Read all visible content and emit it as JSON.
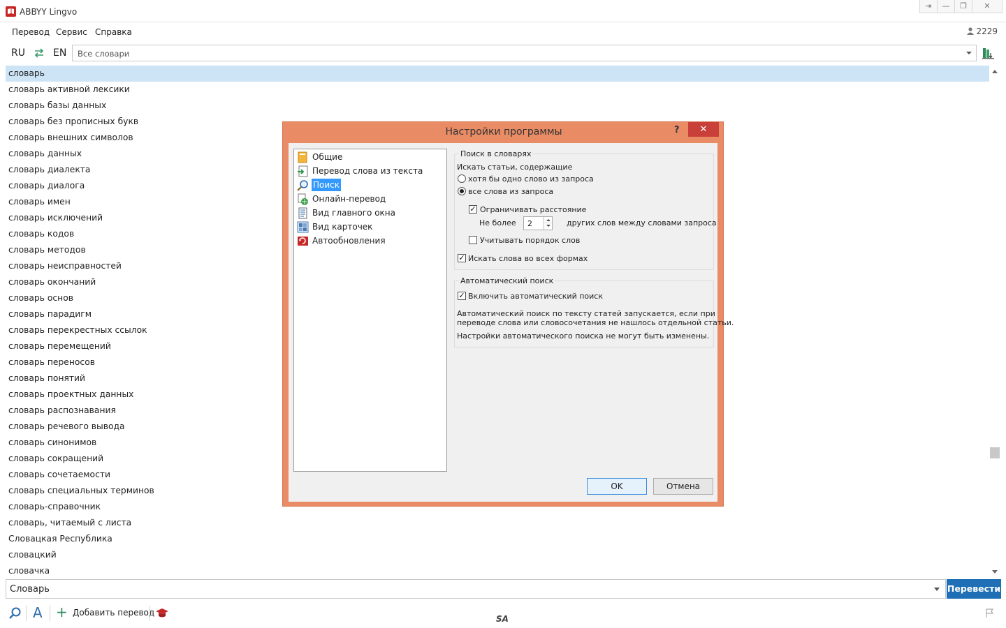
{
  "window": {
    "title": "ABBYY Lingvo",
    "pin_glyph": "⇥",
    "minimize_glyph": "—",
    "restore_glyph": "❐",
    "close_glyph": "✕"
  },
  "menu": {
    "items": [
      "Перевод",
      "Сервис",
      "Справка"
    ],
    "counter": "2229"
  },
  "toolbar": {
    "source_lang": "RU",
    "target_lang": "EN",
    "dictionary_filter": "Все словари"
  },
  "word_list": [
    "словарь",
    "словарь активной лексики",
    "словарь базы данных",
    "словарь без прописных букв",
    "словарь внешних символов",
    "словарь данных",
    "словарь диалекта",
    "словарь диалога",
    "словарь имен",
    "словарь исключений",
    "словарь кодов",
    "словарь методов",
    "словарь неисправностей",
    "словарь окончаний",
    "словарь основ",
    "словарь парадигм",
    "словарь перекрестных ссылок",
    "словарь перемещений",
    "словарь переносов",
    "словарь понятий",
    "словарь проектных данных",
    "словарь распознавания",
    "словарь речевого вывода",
    "словарь синонимов",
    "словарь сокращений",
    "словарь сочетаемости",
    "словарь специальных терминов",
    "словарь-справочник",
    "словарь, читаемый с листа",
    "Словацкая Республика",
    "словацкий",
    "словачка"
  ],
  "search_input": {
    "value": "Словарь",
    "translate_button": "Перевести"
  },
  "statusbar": {
    "add_translation": "Добавить перевод",
    "sa_label": "SA",
    "font_glyph": "A",
    "plus_glyph": "+"
  },
  "dialog": {
    "title": "Настройки программы",
    "help_glyph": "?",
    "close_glyph": "✕",
    "nav": [
      {
        "label": "Общие",
        "icon": "general-icon"
      },
      {
        "label": "Перевод слова из текста",
        "icon": "text-translate-icon"
      },
      {
        "label": "Поиск",
        "icon": "search-icon"
      },
      {
        "label": "Онлайн-перевод",
        "icon": "online-icon"
      },
      {
        "label": "Вид главного окна",
        "icon": "main-window-icon"
      },
      {
        "label": "Вид карточек",
        "icon": "cards-icon"
      },
      {
        "label": "Автообновления",
        "icon": "updates-icon"
      }
    ],
    "selected_nav": "Поиск",
    "search_group": {
      "title": "Поиск в словарях",
      "find_label": "Искать статьи, содержащие",
      "radio_any": "хотя бы одно слово из запроса",
      "radio_all": "все слова из запроса",
      "radio_selected": "all",
      "limit_distance": "Ограничивать расстояние",
      "limit_distance_checked": true,
      "no_more_than": "Не более",
      "distance_value": "2",
      "other_words": "других слов между словами запроса",
      "word_order": "Учитывать порядок слов",
      "word_order_checked": false,
      "all_forms": "Искать слова во всех формах",
      "all_forms_checked": true
    },
    "auto_group": {
      "title": "Автоматический поиск",
      "enable": "Включить автоматический поиск",
      "enable_checked": true,
      "desc1_line1": "Автоматический поиск по тексту статей запускается, если при",
      "desc1_line2": "переводе слова или словосочетания не нашлось отдельной статьи.",
      "desc2": "Настройки автоматического поиска не могут быть изменены."
    },
    "ok": "OK",
    "cancel": "Отмена",
    "check_glyph": "✓"
  },
  "colors": {
    "dialog_frame": "#e98c66",
    "close_red": "#c9403a",
    "accent_blue": "#1e6fb5",
    "selection": "#cde4f7"
  }
}
